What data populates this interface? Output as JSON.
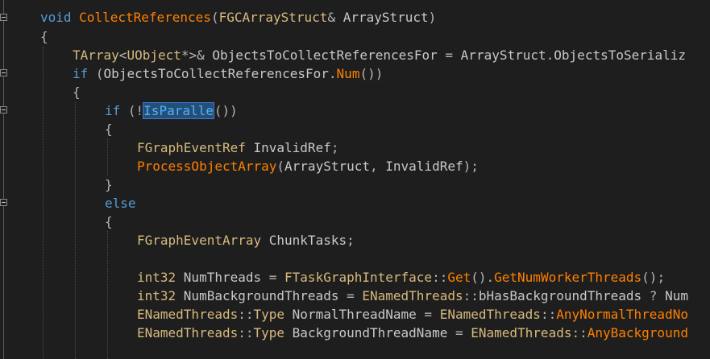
{
  "editor": {
    "lines": [
      {
        "tokens": [
          {
            "t": "void ",
            "c": "kw"
          },
          {
            "t": "CollectReferences",
            "c": "fnd"
          },
          {
            "t": "(",
            "c": "pu"
          },
          {
            "t": "FGCArrayStruct",
            "c": "mac"
          },
          {
            "t": "& ",
            "c": "pu"
          },
          {
            "t": "ArrayStruct",
            "c": "id"
          },
          {
            "t": ")",
            "c": "pu"
          }
        ]
      },
      {
        "tokens": [
          {
            "t": "{",
            "c": "pu"
          }
        ]
      },
      {
        "tokens": [
          {
            "t": "TArray",
            "c": "mac"
          },
          {
            "t": "<",
            "c": "pu"
          },
          {
            "t": "UObject",
            "c": "mac"
          },
          {
            "t": "*>& ",
            "c": "pu"
          },
          {
            "t": "ObjectsToCollectReferencesFor",
            "c": "id"
          },
          {
            "t": " = ",
            "c": "pu"
          },
          {
            "t": "ArrayStruct",
            "c": "id"
          },
          {
            "t": ".",
            "c": "pu"
          },
          {
            "t": "ObjectsToSerializ",
            "c": "id"
          }
        ]
      },
      {
        "tokens": [
          {
            "t": "if ",
            "c": "kw"
          },
          {
            "t": "(",
            "c": "pu"
          },
          {
            "t": "ObjectsToCollectReferencesFor",
            "c": "id"
          },
          {
            "t": ".",
            "c": "pu"
          },
          {
            "t": "Num",
            "c": "fn"
          },
          {
            "t": "())",
            "c": "pu"
          }
        ]
      },
      {
        "tokens": [
          {
            "t": "{",
            "c": "pu"
          }
        ]
      },
      {
        "tokens": [
          {
            "t": "if ",
            "c": "kw"
          },
          {
            "t": "(!",
            "c": "pu"
          },
          {
            "t": "IsParalle",
            "c": "sel"
          },
          {
            "t": "",
            "c": "caret"
          },
          {
            "t": "())",
            "c": "pu"
          }
        ]
      },
      {
        "tokens": [
          {
            "t": "{",
            "c": "pu"
          }
        ]
      },
      {
        "tokens": [
          {
            "t": "FGraphEventRef ",
            "c": "mac"
          },
          {
            "t": "InvalidRef",
            "c": "id"
          },
          {
            "t": ";",
            "c": "pu"
          }
        ]
      },
      {
        "tokens": [
          {
            "t": "ProcessObjectArray",
            "c": "fn"
          },
          {
            "t": "(",
            "c": "pu"
          },
          {
            "t": "ArrayStruct",
            "c": "id"
          },
          {
            "t": ", ",
            "c": "pu"
          },
          {
            "t": "InvalidRef",
            "c": "id"
          },
          {
            "t": ");",
            "c": "pu"
          }
        ]
      },
      {
        "tokens": [
          {
            "t": "}",
            "c": "pu"
          }
        ]
      },
      {
        "tokens": [
          {
            "t": "else",
            "c": "kw"
          }
        ]
      },
      {
        "tokens": [
          {
            "t": "{",
            "c": "pu"
          }
        ]
      },
      {
        "tokens": [
          {
            "t": "FGraphEventArray ",
            "c": "mac"
          },
          {
            "t": "ChunkTasks",
            "c": "id"
          },
          {
            "t": ";",
            "c": "pu"
          }
        ]
      },
      {
        "tokens": []
      },
      {
        "tokens": [
          {
            "t": "int32 ",
            "c": "mac"
          },
          {
            "t": "NumThreads",
            "c": "id"
          },
          {
            "t": " = ",
            "c": "pu"
          },
          {
            "t": "FTaskGraphInterface",
            "c": "mac"
          },
          {
            "t": "::",
            "c": "pu"
          },
          {
            "t": "Get",
            "c": "fn"
          },
          {
            "t": "().",
            "c": "pu"
          },
          {
            "t": "GetNumWorkerThreads",
            "c": "fn"
          },
          {
            "t": "();",
            "c": "pu"
          }
        ]
      },
      {
        "tokens": [
          {
            "t": "int32 ",
            "c": "mac"
          },
          {
            "t": "NumBackgroundThreads",
            "c": "id"
          },
          {
            "t": " = ",
            "c": "pu"
          },
          {
            "t": "ENamedThreads",
            "c": "mac"
          },
          {
            "t": "::",
            "c": "pu"
          },
          {
            "t": "bHasBackgroundThreads",
            "c": "id"
          },
          {
            "t": " ? ",
            "c": "pu"
          },
          {
            "t": "Num",
            "c": "id"
          }
        ]
      },
      {
        "tokens": [
          {
            "t": "ENamedThreads",
            "c": "mac"
          },
          {
            "t": "::",
            "c": "pu"
          },
          {
            "t": "Type ",
            "c": "mac"
          },
          {
            "t": "NormalThreadName",
            "c": "id"
          },
          {
            "t": " = ",
            "c": "pu"
          },
          {
            "t": "ENamedThreads",
            "c": "mac"
          },
          {
            "t": "::",
            "c": "pu"
          },
          {
            "t": "AnyNormalThreadNo",
            "c": "fn"
          }
        ]
      },
      {
        "tokens": [
          {
            "t": "ENamedThreads",
            "c": "mac"
          },
          {
            "t": "::",
            "c": "pu"
          },
          {
            "t": "Type ",
            "c": "mac"
          },
          {
            "t": "BackgroundThreadName",
            "c": "id"
          },
          {
            "t": " = ",
            "c": "pu"
          },
          {
            "t": "ENamedThreads",
            "c": "mac"
          },
          {
            "t": "::",
            "c": "pu"
          },
          {
            "t": "AnyBackground",
            "c": "fn"
          }
        ]
      }
    ]
  }
}
